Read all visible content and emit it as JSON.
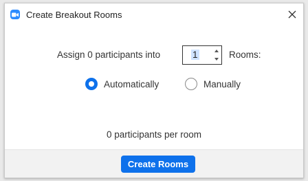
{
  "window": {
    "title": "Create Breakout Rooms",
    "close_glyph": "✕"
  },
  "assign": {
    "prefix": "Assign 0 participants into",
    "room_count": "1",
    "suffix": "Rooms:"
  },
  "mode": {
    "automatic_label": "Automatically",
    "manual_label": "Manually",
    "selected": "Automatically"
  },
  "summary": {
    "per_room_text": "0 participants per room"
  },
  "footer": {
    "create_label": "Create Rooms"
  },
  "colors": {
    "accent": "#0e71eb",
    "app_icon": "#2d8cff"
  },
  "icons": {
    "app": "zoom-camera-icon",
    "close": "close-icon",
    "stepper_up": "chevron-up-icon",
    "stepper_down": "chevron-down-icon"
  }
}
